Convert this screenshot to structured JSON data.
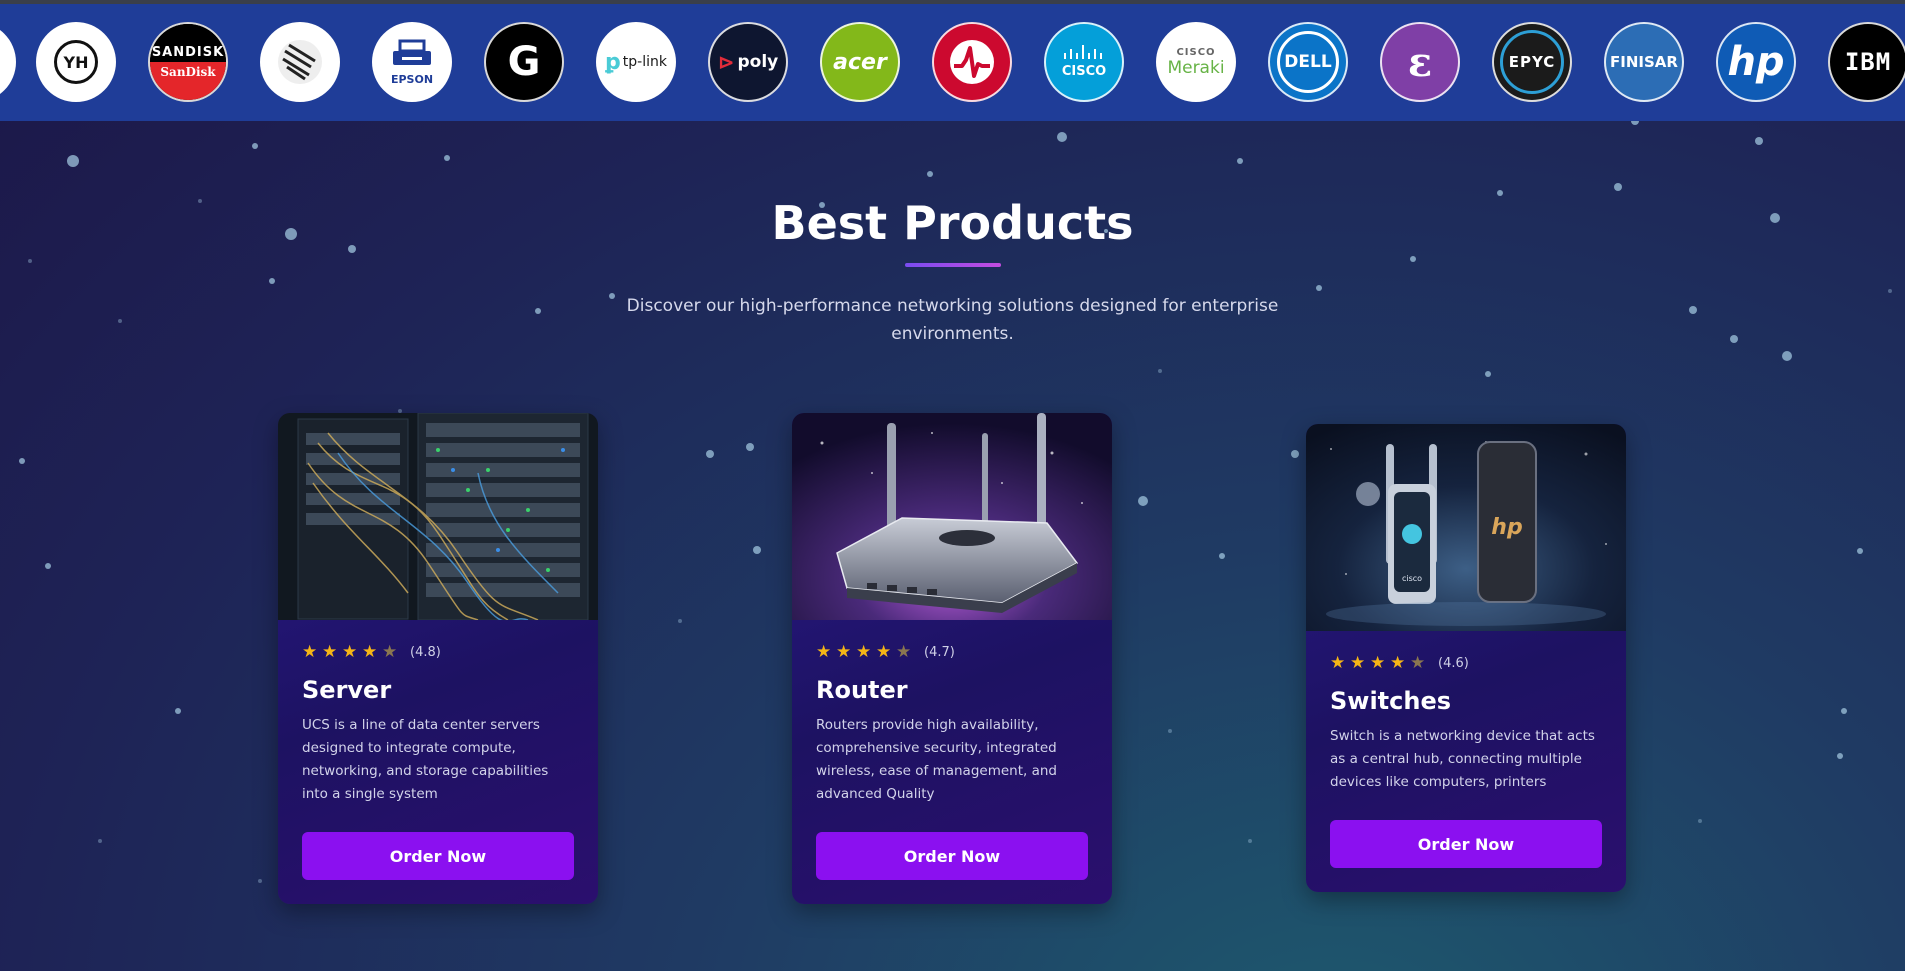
{
  "brands": [
    {
      "name": "partial-brand",
      "label": "",
      "bg": "#ffffff",
      "fg": "#111111"
    },
    {
      "name": "yh",
      "label": "YH",
      "bg": "#ffffff",
      "fg": "#111111"
    },
    {
      "name": "sandisk",
      "label": "SanDisk",
      "bg": "#000000",
      "fg": "#ffffff"
    },
    {
      "name": "zebra",
      "label": "",
      "bg": "#ffffff",
      "fg": "#111111"
    },
    {
      "name": "epson",
      "label": "EPSON",
      "bg": "#ffffff",
      "fg": "#1f3d98"
    },
    {
      "name": "logitech-g",
      "label": "G",
      "bg": "#000000",
      "fg": "#ffffff"
    },
    {
      "name": "tp-link",
      "label": "tp-link",
      "bg": "#ffffff",
      "fg": "#1a1a1a"
    },
    {
      "name": "poly",
      "label": "poly",
      "bg": "#0e1630",
      "fg": "#ffffff"
    },
    {
      "name": "acer",
      "label": "acer",
      "bg": "#83b81a",
      "fg": "#ffffff"
    },
    {
      "name": "broadcom",
      "label": "",
      "bg": "#cc092f",
      "fg": "#ffffff"
    },
    {
      "name": "cisco",
      "label": "CISCO",
      "bg": "#049fd9",
      "fg": "#ffffff"
    },
    {
      "name": "cisco-meraki",
      "label": "Meraki",
      "bg": "#ffffff",
      "fg": "#67b346"
    },
    {
      "name": "dell",
      "label": "DELL",
      "bg": "#0b74c8",
      "fg": "#ffffff"
    },
    {
      "name": "emacs",
      "label": "ε",
      "bg": "#7f3fa6",
      "fg": "#ffffff"
    },
    {
      "name": "epyc",
      "label": "EPYC",
      "bg": "#1b1b1b",
      "fg": "#ffffff"
    },
    {
      "name": "finisar",
      "label": "FINISAR",
      "bg": "#2c6db5",
      "fg": "#ffffff"
    },
    {
      "name": "hp",
      "label": "hp",
      "bg": "#0f5bb5",
      "fg": "#ffffff"
    },
    {
      "name": "ibm",
      "label": "IBM",
      "bg": "#000000",
      "fg": "#ffffff"
    }
  ],
  "section": {
    "title": "Best Products",
    "subtitle": "Discover our high-performance networking solutions designed for enterprise environments."
  },
  "products": [
    {
      "rating": 4.8,
      "rating_text": "(4.8)",
      "stars_filled": 4,
      "title": "Server",
      "description": "UCS is a line of data center servers designed to integrate compute, networking, and storage capabilities into a single system",
      "button": "Order Now"
    },
    {
      "rating": 4.7,
      "rating_text": "(4.7)",
      "stars_filled": 4,
      "title": "Router",
      "description": "Routers provide high availability, comprehensive security, integrated wireless, ease of management, and advanced Quality",
      "button": "Order Now"
    },
    {
      "rating": 4.6,
      "rating_text": "(4.6)",
      "stars_filled": 4,
      "title": "Switches",
      "description": "Switch is a networking device that acts as a central hub, connecting multiple devices like computers, printers",
      "button": "Order Now"
    }
  ],
  "card_image_labels": {
    "switch_device": "cisco"
  },
  "colors": {
    "accent": "#8b10f0",
    "logo_bar": "#1f3d98",
    "star": "#f5b516"
  }
}
